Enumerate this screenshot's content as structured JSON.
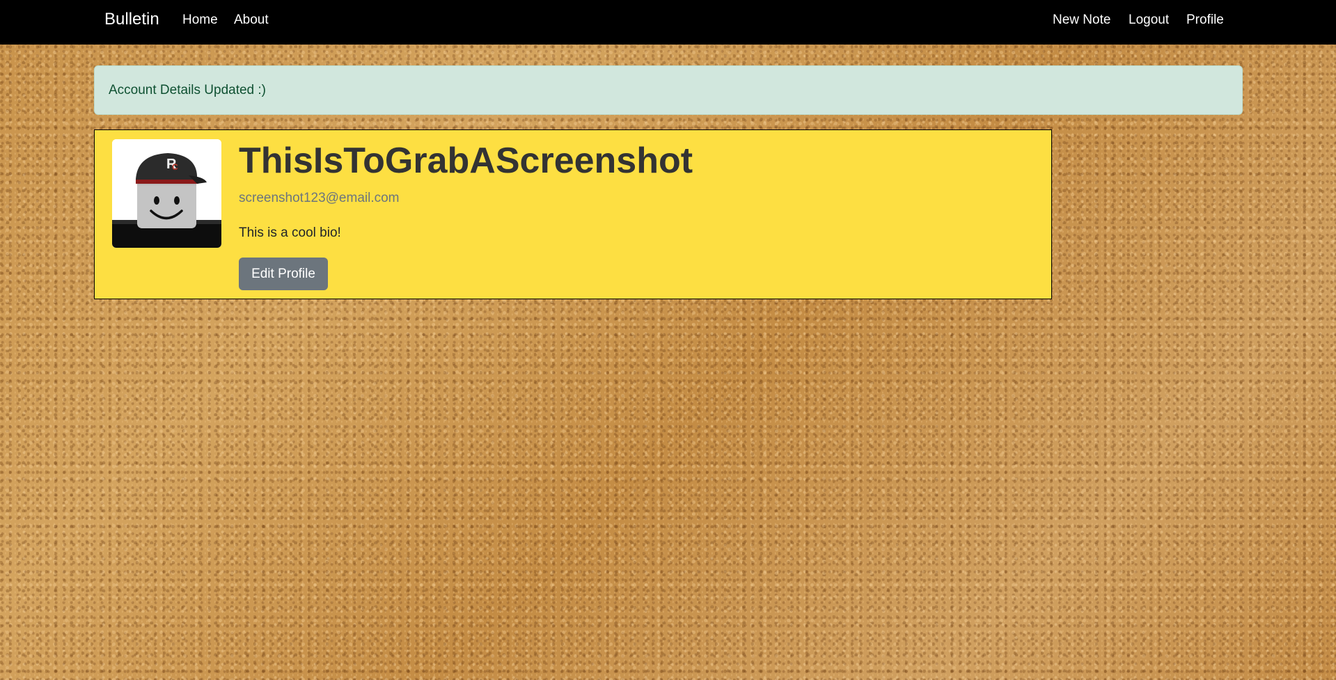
{
  "navbar": {
    "brand": "Bulletin",
    "left_links": [
      "Home",
      "About"
    ],
    "right_links": [
      "New Note",
      "Logout",
      "Profile"
    ]
  },
  "alert": {
    "message": "Account Details Updated :)"
  },
  "profile": {
    "avatar_icon": "roblox-avatar-icon",
    "username": "ThisIsToGrabAScreenshot",
    "email": "screenshot123@email.com",
    "bio": "This is a cool bio!",
    "edit_label": "Edit Profile"
  },
  "colors": {
    "navbar_bg": "#000000",
    "alert_bg": "#d1e7dd",
    "alert_text": "#0f5132",
    "card_bg": "#fddf42",
    "button_bg": "#6c757d",
    "page_bg": "#c9974f"
  }
}
